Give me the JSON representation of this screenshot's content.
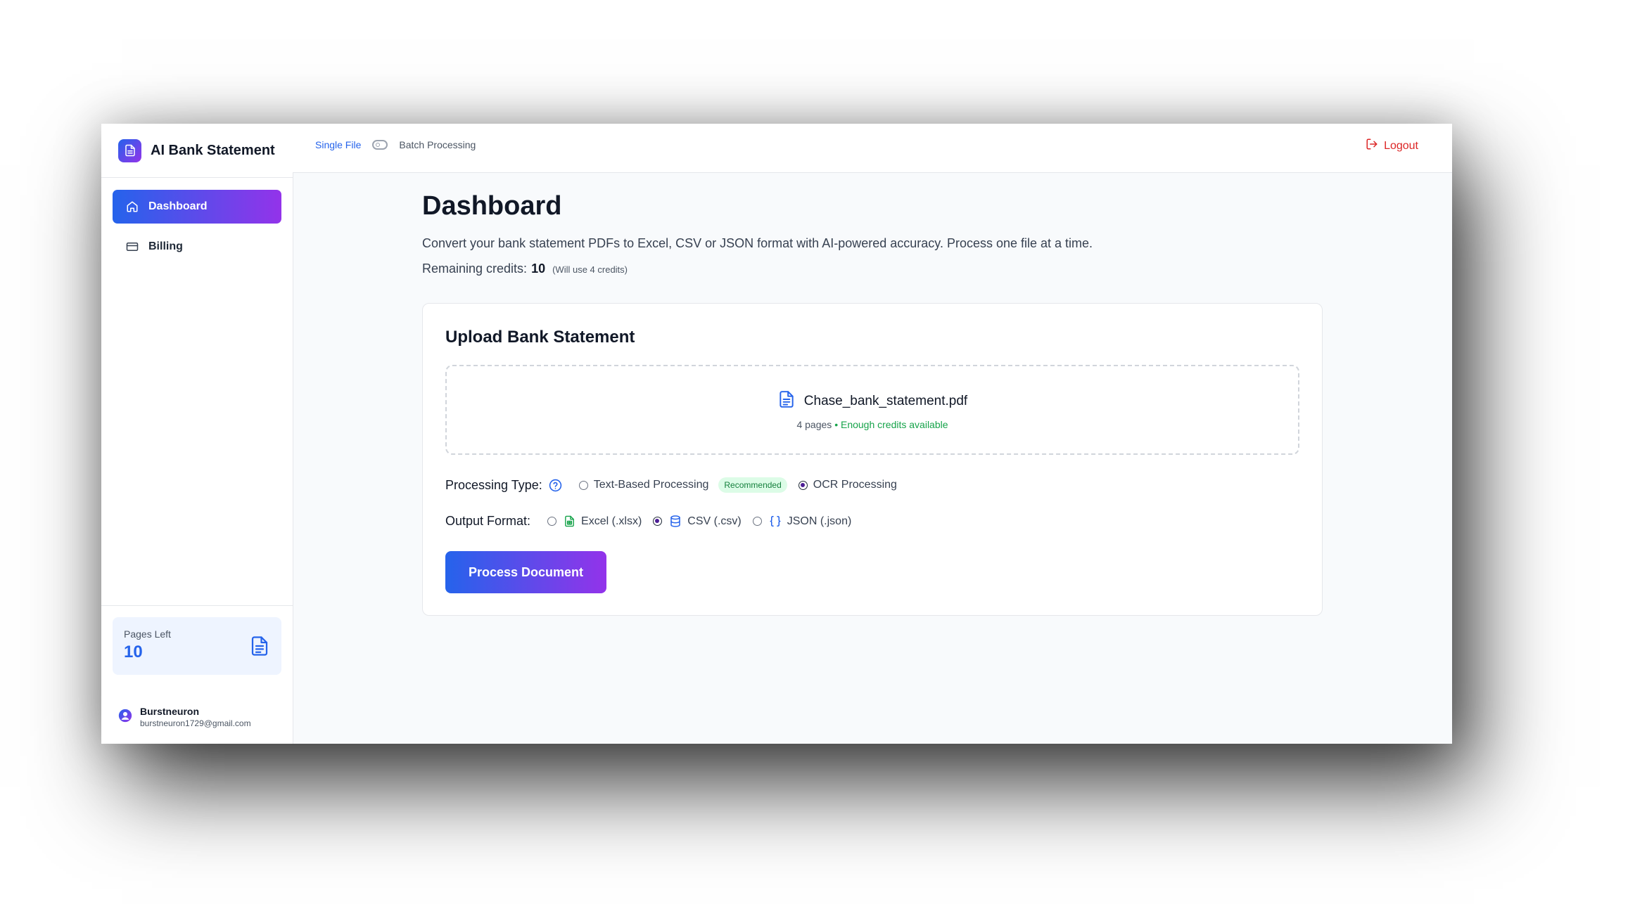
{
  "app": {
    "title": "AI Bank Statement"
  },
  "sidebar": {
    "items": [
      {
        "label": "Dashboard",
        "icon": "home-icon"
      },
      {
        "label": "Billing",
        "icon": "credit-card-icon"
      }
    ],
    "pages_left": {
      "label": "Pages Left",
      "value": "10"
    },
    "user": {
      "name": "Burstneuron",
      "email": "burstneuron1729@gmail.com"
    }
  },
  "topbar": {
    "mode_single": "Single File",
    "mode_batch": "Batch Processing",
    "mode_batch_enabled": false,
    "logout": "Logout"
  },
  "main": {
    "title": "Dashboard",
    "description": "Convert your bank statement PDFs to Excel, CSV or JSON format with AI-powered accuracy. Process one file at a time.",
    "credits_label": "Remaining credits:",
    "credits_value": "10",
    "credits_note": "(Will use 4 credits)",
    "upload": {
      "title": "Upload Bank Statement",
      "file_name": "Chase_bank_statement.pdf",
      "file_pages": "4 pages",
      "separator": "•",
      "file_status": "Enough credits available"
    },
    "processing": {
      "label": "Processing Type:",
      "options": [
        {
          "label": "Text-Based Processing",
          "badge": "Recommended",
          "selected": false
        },
        {
          "label": "OCR Processing",
          "selected": true
        }
      ]
    },
    "output": {
      "label": "Output Format:",
      "options": [
        {
          "label": "Excel (.xlsx)",
          "icon": "spreadsheet-icon",
          "selected": false
        },
        {
          "label": "CSV (.csv)",
          "icon": "database-icon",
          "selected": true
        },
        {
          "label": "JSON (.json)",
          "icon": "braces-icon",
          "selected": false
        }
      ]
    },
    "process_button": "Process Document"
  },
  "colors": {
    "accent_start": "#2563eb",
    "accent_end": "#9333ea",
    "success": "#16a34a",
    "danger": "#dc2626"
  }
}
